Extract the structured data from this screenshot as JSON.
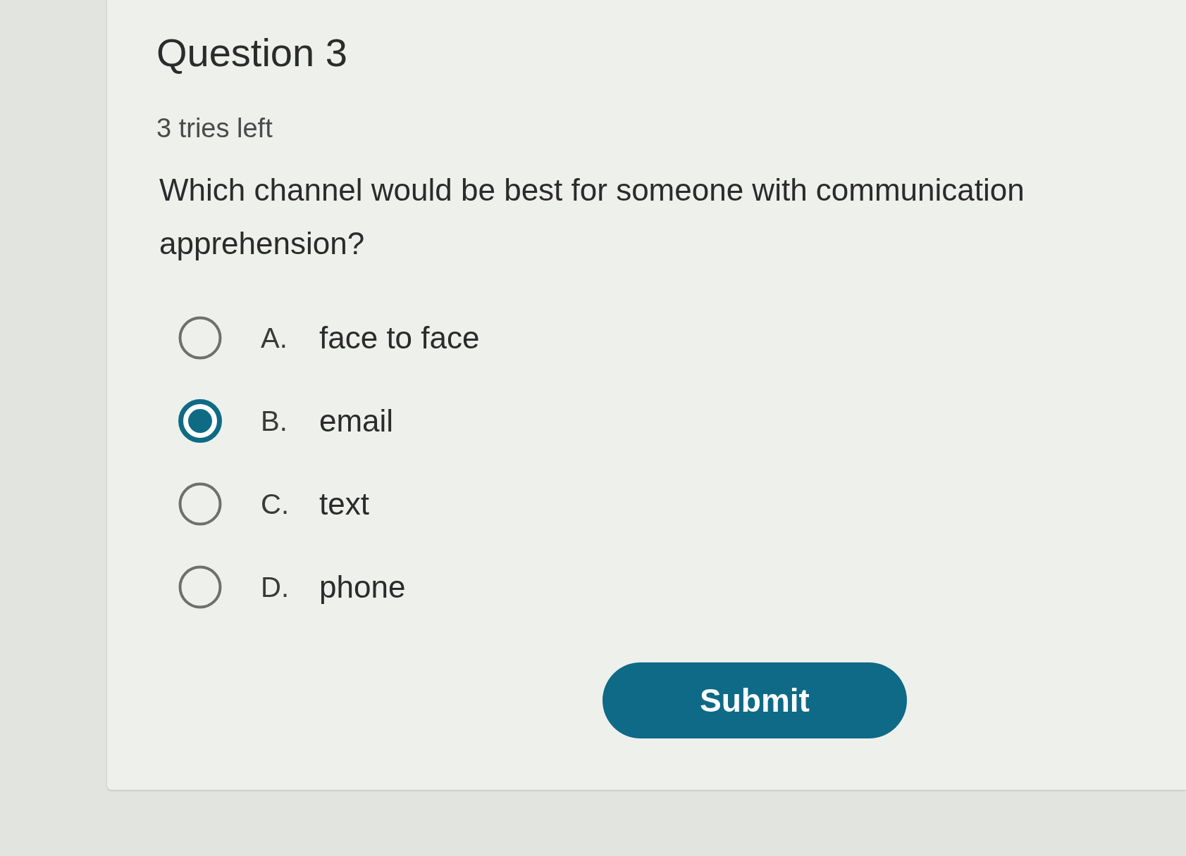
{
  "title": "Question 3",
  "tries": "3 tries left",
  "question": "Which channel would be best for someone with communication apprehension?",
  "options": [
    {
      "letter": "A.",
      "label": "face to face",
      "selected": false
    },
    {
      "letter": "B.",
      "label": "email",
      "selected": true
    },
    {
      "letter": "C.",
      "label": "text",
      "selected": false
    },
    {
      "letter": "D.",
      "label": "phone",
      "selected": false
    }
  ],
  "submit": "Submit"
}
